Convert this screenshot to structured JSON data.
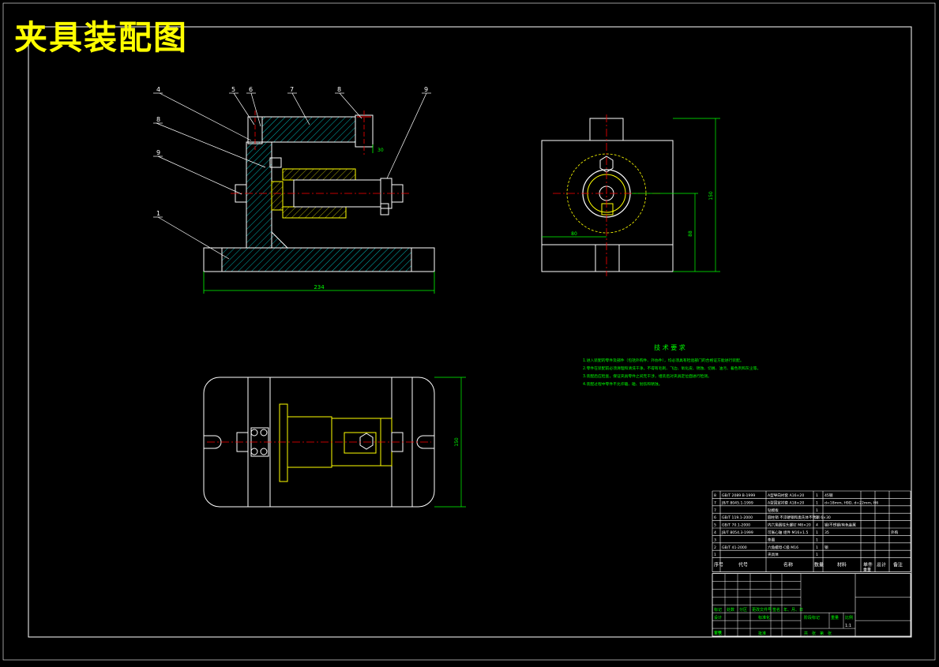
{
  "drawing": {
    "title": "夹具装配图",
    "colors": {
      "background": "#000000",
      "frame": "#ffffff",
      "part": "#ffffff",
      "hatch": "#00ffff",
      "highlight": "#ffff00",
      "centerline": "#ff0000",
      "dimension": "#00ff00",
      "leader": "#ffffff"
    }
  },
  "front_view": {
    "balloons": [
      "4",
      "5",
      "6",
      "7",
      "8",
      "8",
      "9",
      "1",
      "9"
    ],
    "dims": [
      "234",
      "30"
    ]
  },
  "side_view": {
    "dims": [
      "150",
      "88",
      "80"
    ]
  },
  "top_view": {
    "dims": [
      "150"
    ]
  },
  "technical_requirements": {
    "heading": "技 术 要 求",
    "lines": [
      "1.进入装配的零件及部件（包括外购件、外协件），均必须具有检验部门的合格证方能进行装配。",
      "2.零件在装配前必须清理和清洗干净，不得有毛刺、飞边、氧化皮、锈蚀、切屑、油污、着色剂和灰尘等。",
      "3.装配后应检查，保证夹具零件之间无干涉，组装后对夹具定位面进行检测。",
      "4.装配过程中零件不允许磕、碰、划伤和锈蚀。"
    ]
  },
  "bom": {
    "headers": [
      "序号",
      "代号",
      "名称",
      "数量",
      "材料",
      "单件",
      "总计",
      "重量",
      "备注"
    ],
    "rows": [
      {
        "no": "8",
        "code": "GB/T 2089 B-1999",
        "name": "A型导向衬套 A16×20",
        "qty": "1",
        "mat": "45钢",
        "note": ""
      },
      {
        "no": "7",
        "code": "JB/T 8045.1-1999",
        "name": "A型固定衬套 A18×20",
        "qty": "1",
        "mat": "d=18mm, H9D, d=22mm, H6",
        "note": ""
      },
      {
        "no": "7",
        "code": "",
        "name": "钻模板",
        "qty": "1",
        "mat": "",
        "note": ""
      },
      {
        "no": "6",
        "code": "GB/T 119.1-2000",
        "name": "圆柱销 不淬硬钢和奥氏体不锈钢 6×30",
        "qty": "2",
        "mat": "",
        "note": ""
      },
      {
        "no": "5",
        "code": "GB/T 70.1-2000",
        "name": "内六角圆柱头螺钉 M8×20",
        "qty": "4",
        "mat": "钢/不锈钢/有色金属",
        "note": ""
      },
      {
        "no": "4",
        "code": "JB/T 8054.3-1999",
        "name": "可胀心轴 组件 M16×1.5",
        "qty": "1",
        "mat": "35",
        "note": "外购"
      },
      {
        "no": "3",
        "code": "",
        "name": "垫圈",
        "qty": "1",
        "mat": "",
        "note": ""
      },
      {
        "no": "2",
        "code": "GB/T 41-2000",
        "name": "六角螺母-C级 M16",
        "qty": "1",
        "mat": "钢",
        "note": ""
      },
      {
        "no": "1",
        "code": "",
        "name": "夹具体",
        "qty": "1",
        "mat": "",
        "note": ""
      }
    ],
    "title_block": {
      "labels": [
        "标记",
        "处数",
        "分区",
        "更改文件号",
        "签名",
        "年、月、日",
        "设计",
        "标准化",
        "阶段标记",
        "重量",
        "比例",
        "审核",
        "工艺",
        "批准"
      ],
      "sheet_text": "共　张　第　张",
      "scale": "1:1"
    }
  }
}
